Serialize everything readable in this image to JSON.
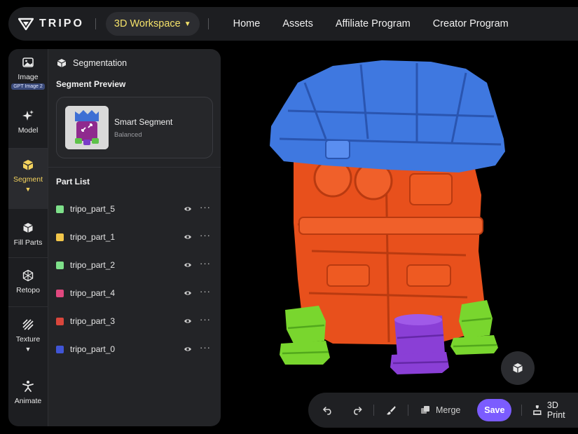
{
  "header": {
    "logo_text": "TRIPO",
    "workspace_label": "3D Workspace",
    "nav": [
      "Home",
      "Assets",
      "Affiliate Program",
      "Creator Program"
    ]
  },
  "rail": {
    "items": [
      {
        "label": "Image",
        "badge": "GPT Image 2",
        "icon": "image-icon"
      },
      {
        "label": "Model",
        "icon": "sparkle-icon"
      },
      {
        "label": "Segment",
        "icon": "cube-icon",
        "active": true
      },
      {
        "label": "Fill Parts",
        "icon": "box-icon"
      },
      {
        "label": "Retopo",
        "icon": "mesh-icon"
      },
      {
        "label": "Texture",
        "icon": "texture-icon"
      },
      {
        "label": "Animate",
        "icon": "figure-icon"
      }
    ]
  },
  "panel": {
    "title": "Segmentation",
    "preview_title": "Segment Preview",
    "segment_card": {
      "name": "Smart Segment",
      "mode": "Balanced"
    },
    "part_list_title": "Part List",
    "parts": [
      {
        "name": "tripo_part_5",
        "color": "#7ee08a"
      },
      {
        "name": "tripo_part_1",
        "color": "#f2c64a"
      },
      {
        "name": "tripo_part_2",
        "color": "#7ee08a"
      },
      {
        "name": "tripo_part_4",
        "color": "#e0487f"
      },
      {
        "name": "tripo_part_3",
        "color": "#d9463c"
      },
      {
        "name": "tripo_part_0",
        "color": "#4055d6"
      }
    ]
  },
  "toolbar": {
    "merge_label": "Merge",
    "save_label": "Save",
    "print_label": "3D Print"
  },
  "colors": {
    "accent": "#7b5cff",
    "active_tab": "#f4d35e",
    "model_top": "#3f78e0",
    "model_body": "#e8501c",
    "model_feet": "#79d62e",
    "model_front_foot": "#8a3fd6"
  }
}
